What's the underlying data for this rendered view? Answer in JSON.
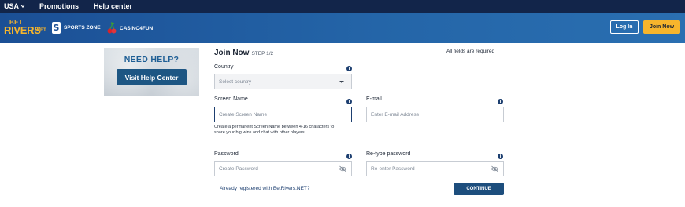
{
  "topbar": {
    "region": "USA",
    "links": [
      "Promotions",
      "Help center"
    ]
  },
  "header": {
    "logo": {
      "line1": "BET",
      "line2": "RIVERS",
      "suffix": ".NET"
    },
    "brands": [
      {
        "mark": "S",
        "label": "SPORTS ZONE"
      },
      {
        "label": "CASINO4FUN"
      }
    ],
    "login_label": "Log In",
    "join_label": "Join Now"
  },
  "help_panel": {
    "title": "NEED HELP?",
    "button_label": "Visit Help Center"
  },
  "form": {
    "title": "Join Now",
    "step": "STEP 1/2",
    "required_note": "All fields are required",
    "country": {
      "label": "Country",
      "placeholder": "Select country"
    },
    "screen_name": {
      "label": "Screen Name",
      "placeholder": "Create Screen Name",
      "hint": "Create a permanent Screen Name between 4-16 characters to share your big wins and chat with other players."
    },
    "email": {
      "label": "E-mail",
      "placeholder": "Enter E-mail Address"
    },
    "password": {
      "label": "Password",
      "placeholder": "Create Password"
    },
    "retype_password": {
      "label": "Re-type password",
      "placeholder": "Re-enter Password"
    },
    "info_glyph": "i",
    "already_registered": "Already registered with BetRivers.NET?",
    "continue_label": "CONTINUE"
  },
  "icons": {
    "region_chevron": "chevron-down-icon",
    "info": "info-icon",
    "eye": "eye-slash-icon",
    "select_caret": "caret-down-icon",
    "cherries": "cherries-icon"
  },
  "colors": {
    "topbar": "#12254a",
    "header": "#2465a8",
    "accent": "#f7b52c",
    "primary_button": "#1d4e7d"
  }
}
